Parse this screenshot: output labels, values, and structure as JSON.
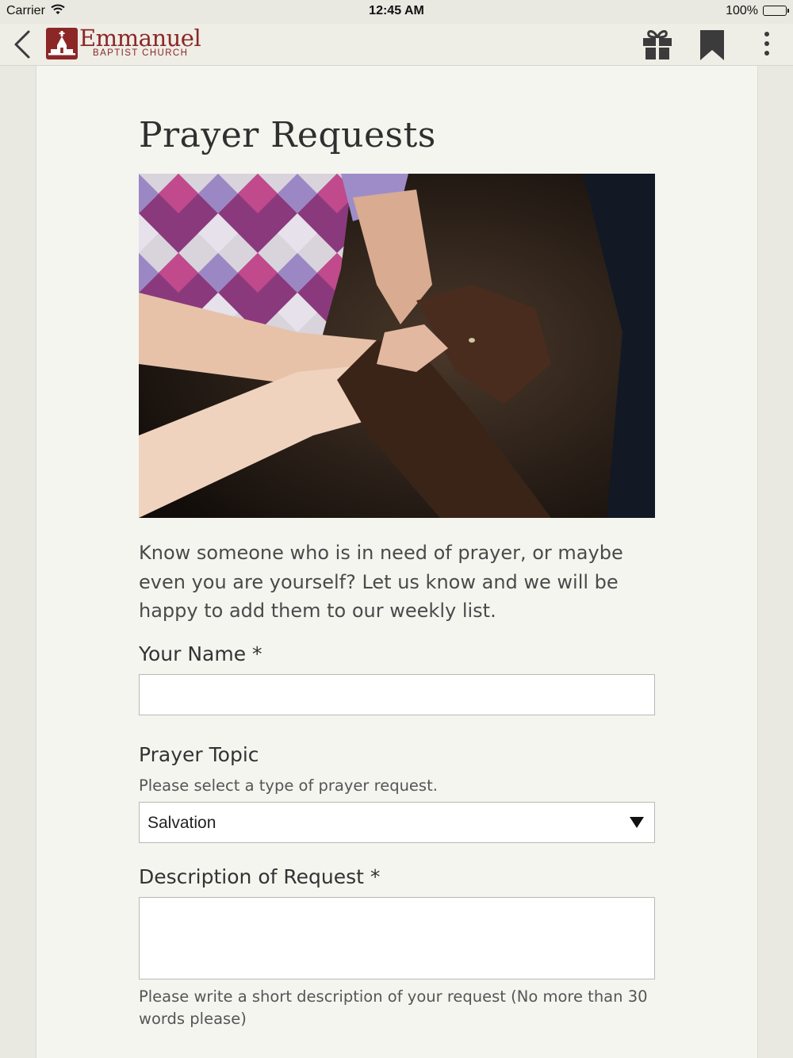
{
  "status_bar": {
    "carrier": "Carrier",
    "time": "12:45 AM",
    "battery": "100%"
  },
  "nav": {
    "logo_title": "Emmanuel",
    "logo_subtitle": "BAPTIST CHURCH",
    "icons": [
      "back-chevron-icon",
      "church-logo-icon",
      "gift-icon",
      "bookmark-icon",
      "more-vertical-icon"
    ],
    "colors": {
      "brand": "#8c2727",
      "icon": "#3b3b3b"
    }
  },
  "page": {
    "title": "Prayer Requests",
    "intro": "Know someone who is in need of prayer, or maybe even you are yourself? Let us know and we will be happy to add them to our weekly list."
  },
  "form": {
    "name_label": "Your Name *",
    "name_value": "",
    "topic_label": "Prayer Topic",
    "topic_help": "Please select a type of prayer request.",
    "topic_selected": "Salvation",
    "description_label": "Description of Request *",
    "description_value": "",
    "description_help": "Please write a short description of your request (No more than 30 words please)"
  }
}
